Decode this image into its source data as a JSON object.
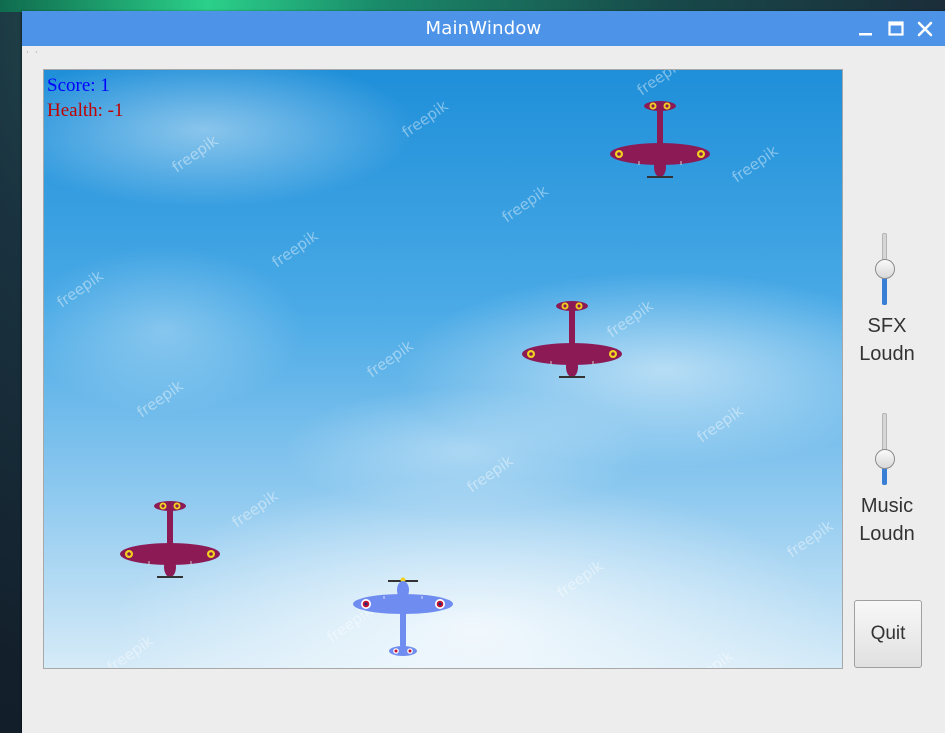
{
  "window": {
    "title": "MainWindow"
  },
  "hud": {
    "score": "Score: 1",
    "health": "Health: -1"
  },
  "watermark": "freepik",
  "controls": {
    "sfx_label_line1": "SFX",
    "sfx_label_line2": "Loudn",
    "sfx_level": 0.5,
    "music_label_line1": "Music",
    "music_label_line2": "Loudn",
    "music_level": 0.3,
    "quit_label": "Quit"
  },
  "colors": {
    "enemy_plane": "#8b1a55",
    "player_plane": "#6f8cf0",
    "titlebar": "#4d94e8",
    "score_text": "#0000ff",
    "health_text": "#c00000"
  },
  "icons": [
    "minimize-icon",
    "maximize-icon",
    "close-icon",
    "enemy-plane-icon",
    "player-plane-icon"
  ]
}
